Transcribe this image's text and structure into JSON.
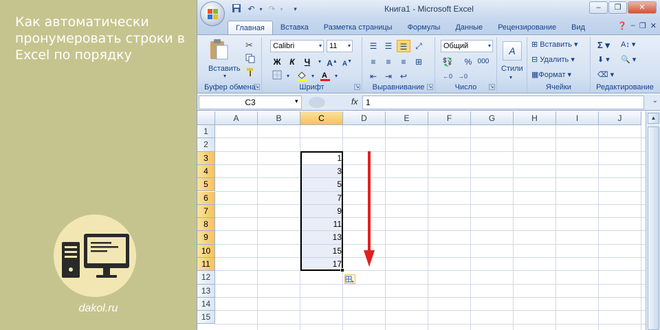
{
  "promo": {
    "title": "Как автоматически пронумеровать строки в Excel по порядку",
    "site": "dakol.ru"
  },
  "window": {
    "title": "Книга1 - Microsoft Excel"
  },
  "tabs": [
    {
      "label": "Главная",
      "active": true
    },
    {
      "label": "Вставка"
    },
    {
      "label": "Разметка страницы"
    },
    {
      "label": "Формулы"
    },
    {
      "label": "Данные"
    },
    {
      "label": "Рецензирование"
    },
    {
      "label": "Вид"
    }
  ],
  "ribbon": {
    "clipboard": {
      "label": "Буфер обмена",
      "paste": "Вставить"
    },
    "font": {
      "label": "Шрифт",
      "name": "Calibri",
      "size": "11",
      "bold": "Ж",
      "italic": "К",
      "underline": "Ч"
    },
    "alignment": {
      "label": "Выравнивание"
    },
    "number": {
      "label": "Число",
      "format": "Общий",
      "percent": "%",
      "thousands": "000"
    },
    "styles": {
      "label": "Стили"
    },
    "cells": {
      "label": "Ячейки",
      "insert": "Вставить",
      "delete": "Удалить",
      "format": "Формат"
    },
    "editing": {
      "label": "Редактирование"
    }
  },
  "formula_bar": {
    "name_box": "C3",
    "fx": "fx",
    "value": "1"
  },
  "columns": [
    "A",
    "B",
    "C",
    "D",
    "E",
    "F",
    "G",
    "H",
    "I",
    "J"
  ],
  "rows": [
    "1",
    "2",
    "3",
    "4",
    "5",
    "6",
    "7",
    "8",
    "9",
    "10",
    "11",
    "12",
    "13",
    "14",
    "15"
  ],
  "cells_c": [
    {
      "row": "3",
      "value": "1"
    },
    {
      "row": "4",
      "value": "3"
    },
    {
      "row": "5",
      "value": "5"
    },
    {
      "row": "6",
      "value": "7"
    },
    {
      "row": "7",
      "value": "9"
    },
    {
      "row": "8",
      "value": "11"
    },
    {
      "row": "9",
      "value": "13"
    },
    {
      "row": "10",
      "value": "15"
    },
    {
      "row": "11",
      "value": "17"
    }
  ],
  "selected_column": "C",
  "selected_rows": [
    "3",
    "4",
    "5",
    "6",
    "7",
    "8",
    "9",
    "10",
    "11"
  ],
  "colors": {
    "panel": "#c6c48e",
    "arrow": "#e02020",
    "ribbon_text": "#15428b"
  }
}
